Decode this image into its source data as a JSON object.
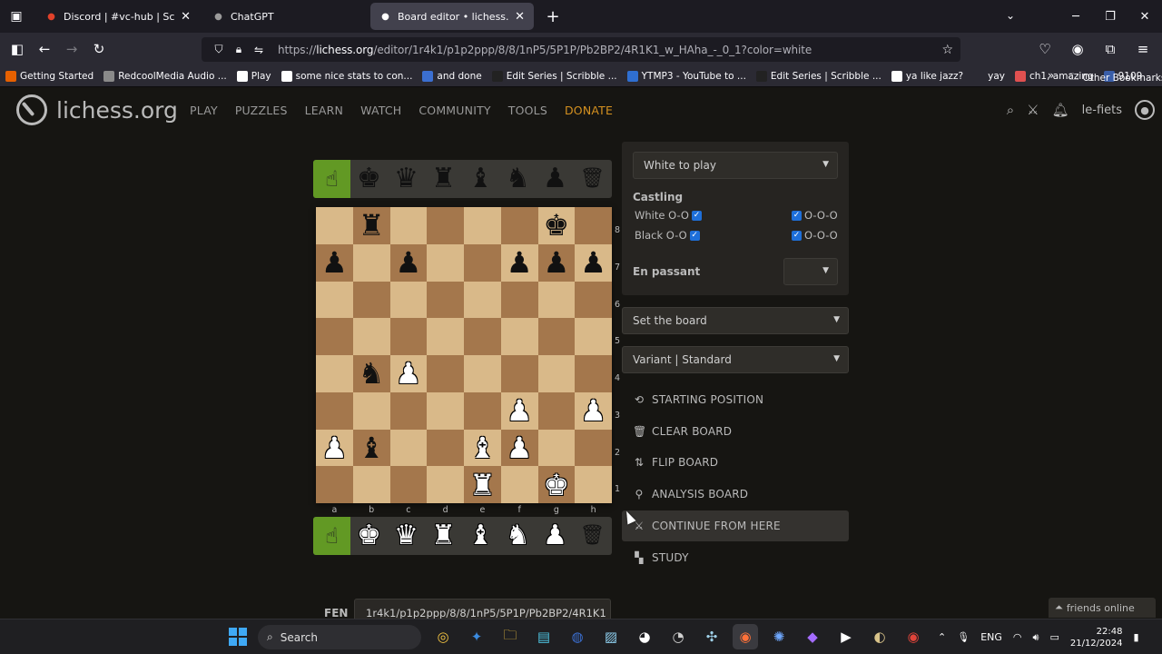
{
  "browser": {
    "tabs": [
      {
        "title": "Discord | #vc-hub | Scribble Hub",
        "icon": "discord-icon",
        "color": "#e0412a",
        "active": false
      },
      {
        "title": "ChatGPT",
        "icon": "chatgpt-icon",
        "color": "#9a9a9a",
        "active": false
      },
      {
        "title": "Board editor • lichess.org",
        "icon": "lichess-icon",
        "color": "#ffffff",
        "active": true
      }
    ],
    "url_prefix": "https://",
    "url_host": "lichess.org",
    "url_path": "/editor/1r4k1/p1p2ppp/8/8/1nP5/5P1P/Pb2BP2/4R1K1_w_HAha_-_0_1?color=white",
    "bookmarks": [
      {
        "label": "Getting Started",
        "color": "#e66000"
      },
      {
        "label": "RedcoolMedia Audio ...",
        "color": "#8a8a8a"
      },
      {
        "label": "Play",
        "color": "#ffffff"
      },
      {
        "label": "some nice stats to con...",
        "color": "#ffffff"
      },
      {
        "label": "and done",
        "color": "#3b6fd1"
      },
      {
        "label": "Edit Series | Scribble ...",
        "color": "#222222"
      },
      {
        "label": "YTMP3 - YouTube to ...",
        "color": "#2f6fd1"
      },
      {
        "label": "Edit Series | Scribble ...",
        "color": "#222222"
      },
      {
        "label": "ya like jazz?",
        "color": "#ffffff"
      },
      {
        "label": "yay",
        "color": "#2b2a33"
      },
      {
        "label": "ch1, amazing",
        "color": "#e05050"
      },
      {
        "label": "9109",
        "color": "#3a5ea8"
      }
    ],
    "other_bookmarks": "Other Bookmarks"
  },
  "site": {
    "logo_text": "lichess.org",
    "nav": [
      "PLAY",
      "PUZZLES",
      "LEARN",
      "WATCH",
      "COMMUNITY",
      "TOOLS",
      "DONATE"
    ],
    "username": "le-fiets"
  },
  "editor": {
    "turn_select": "White to play",
    "castling_title": "Castling",
    "white_oo": "White O-O",
    "white_ooo": "O-O-O",
    "black_oo": "Black O-O",
    "black_ooo": "O-O-O",
    "en_passant_label": "En passant",
    "set_board": "Set the board",
    "variant": "Variant | Standard",
    "actions": [
      {
        "label": "STARTING POSITION",
        "icon": "undo-icon",
        "glyph": "⟲"
      },
      {
        "label": "CLEAR BOARD",
        "icon": "trash-icon",
        "glyph": "🗑"
      },
      {
        "label": "FLIP BOARD",
        "icon": "flip-icon",
        "glyph": "⇅"
      },
      {
        "label": "ANALYSIS BOARD",
        "icon": "microscope-icon",
        "glyph": "⚲"
      },
      {
        "label": "CONTINUE FROM HERE",
        "icon": "swords-icon",
        "glyph": "⚔"
      },
      {
        "label": "STUDY",
        "icon": "study-icon",
        "glyph": "▚"
      }
    ],
    "fen_label": "FEN",
    "fen_value": "1r4k1/p1p2ppp/8/8/1nP5/5P1P/Pb2BP2/4R1K1",
    "files": [
      "a",
      "b",
      "c",
      "d",
      "e",
      "f",
      "g",
      "h"
    ],
    "ranks": [
      "8",
      "7",
      "6",
      "5",
      "4",
      "3",
      "2",
      "1"
    ],
    "board": [
      [
        "",
        "r",
        "",
        "",
        "",
        "",
        "k",
        ""
      ],
      [
        "p",
        "",
        "p",
        "",
        "",
        "p",
        "p",
        "p"
      ],
      [
        "",
        "",
        "",
        "",
        "",
        "",
        "",
        ""
      ],
      [
        "",
        "",
        "",
        "",
        "",
        "",
        "",
        ""
      ],
      [
        "",
        "n",
        "P",
        "",
        "",
        "",
        "",
        ""
      ],
      [
        "",
        "",
        "",
        "",
        "",
        "P",
        "",
        "P"
      ],
      [
        "P",
        "b",
        "",
        "",
        "B",
        "P",
        "",
        ""
      ],
      [
        "",
        "",
        "",
        "",
        "R",
        "",
        "K",
        ""
      ]
    ],
    "spare_black": [
      "k",
      "q",
      "r",
      "b",
      "n",
      "p"
    ],
    "spare_white": [
      "K",
      "Q",
      "R",
      "B",
      "N",
      "P"
    ]
  },
  "friends_label": "friends online",
  "taskbar": {
    "search_placeholder": "Search",
    "language": "ENG",
    "time": "22:48",
    "date": "21/12/2024"
  }
}
